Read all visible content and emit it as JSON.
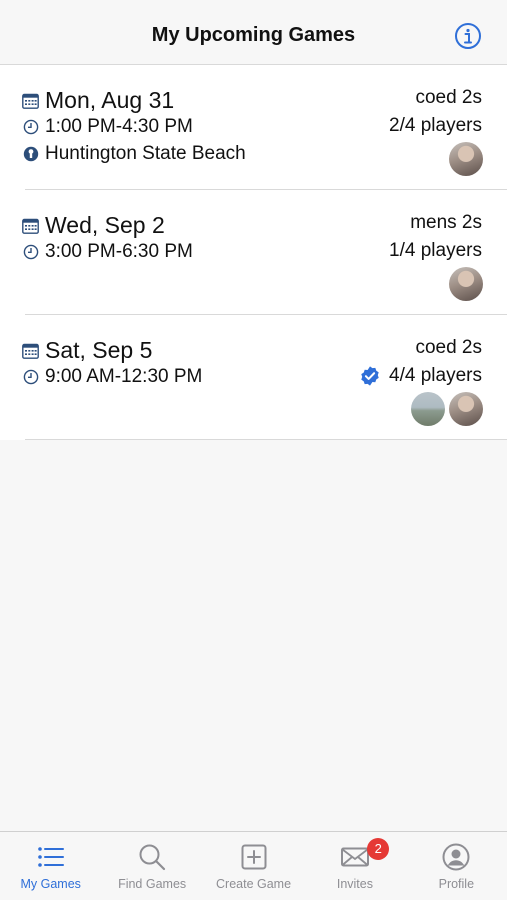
{
  "header": {
    "title": "My Upcoming Games"
  },
  "games": [
    {
      "date": "Mon, Aug 31",
      "time": "1:00 PM-4:30 PM",
      "location": "Huntington State Beach",
      "format": "coed 2s",
      "players": "2/4 players",
      "full": false
    },
    {
      "date": "Wed, Sep 2",
      "time": "3:00 PM-6:30 PM",
      "format": "mens 2s",
      "players": "1/4 players",
      "full": false
    },
    {
      "date": "Sat, Sep 5",
      "time": "9:00 AM-12:30 PM",
      "format": "coed 2s",
      "players": "4/4 players",
      "full": true
    }
  ],
  "tabs": [
    {
      "label": "My Games",
      "icon": "list-icon",
      "active": true
    },
    {
      "label": "Find Games",
      "icon": "search-icon"
    },
    {
      "label": "Create Game",
      "icon": "plus-square-icon"
    },
    {
      "label": "Invites",
      "icon": "envelope-icon",
      "badge": "2"
    },
    {
      "label": "Profile",
      "icon": "person-circle-icon"
    }
  ],
  "colors": {
    "accent": "#2f6fd8",
    "badge": "#e53935",
    "icon": "#2d4e7a"
  }
}
